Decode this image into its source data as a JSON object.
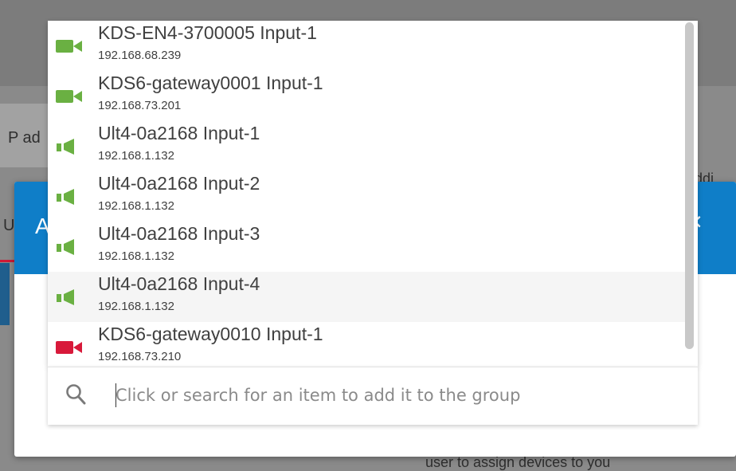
{
  "background": {
    "input_label": "P ad",
    "side_letter": "U",
    "right_fragment": "ddi",
    "bottom_fragment": "user to assign devices to you"
  },
  "dialog": {
    "title_initial": "A",
    "close_glyph": "×"
  },
  "dropdown": {
    "items": [
      {
        "name": "KDS-EN4-3700005 Input-1",
        "ip": "192.168.68.239",
        "icon": "video-camera-icon",
        "color": "#6ab042"
      },
      {
        "name": "KDS6-gateway0001 Input-1",
        "ip": "192.168.73.201",
        "icon": "video-camera-icon",
        "color": "#6ab042"
      },
      {
        "name": "Ult4-0a2168 Input-1",
        "ip": "192.168.1.132",
        "icon": "speaker-icon",
        "color": "#6ab042"
      },
      {
        "name": "Ult4-0a2168 Input-2",
        "ip": "192.168.1.132",
        "icon": "speaker-icon",
        "color": "#6ab042"
      },
      {
        "name": "Ult4-0a2168 Input-3",
        "ip": "192.168.1.132",
        "icon": "speaker-icon",
        "color": "#6ab042"
      },
      {
        "name": "Ult4-0a2168 Input-4",
        "ip": "192.168.1.132",
        "icon": "speaker-icon",
        "color": "#6ab042"
      },
      {
        "name": "KDS6-gateway0010 Input-1",
        "ip": "192.168.73.210",
        "icon": "video-camera-icon",
        "color": "#d8193a"
      }
    ]
  },
  "search": {
    "placeholder": "Click or search for an item to add it to the group",
    "value": ""
  }
}
